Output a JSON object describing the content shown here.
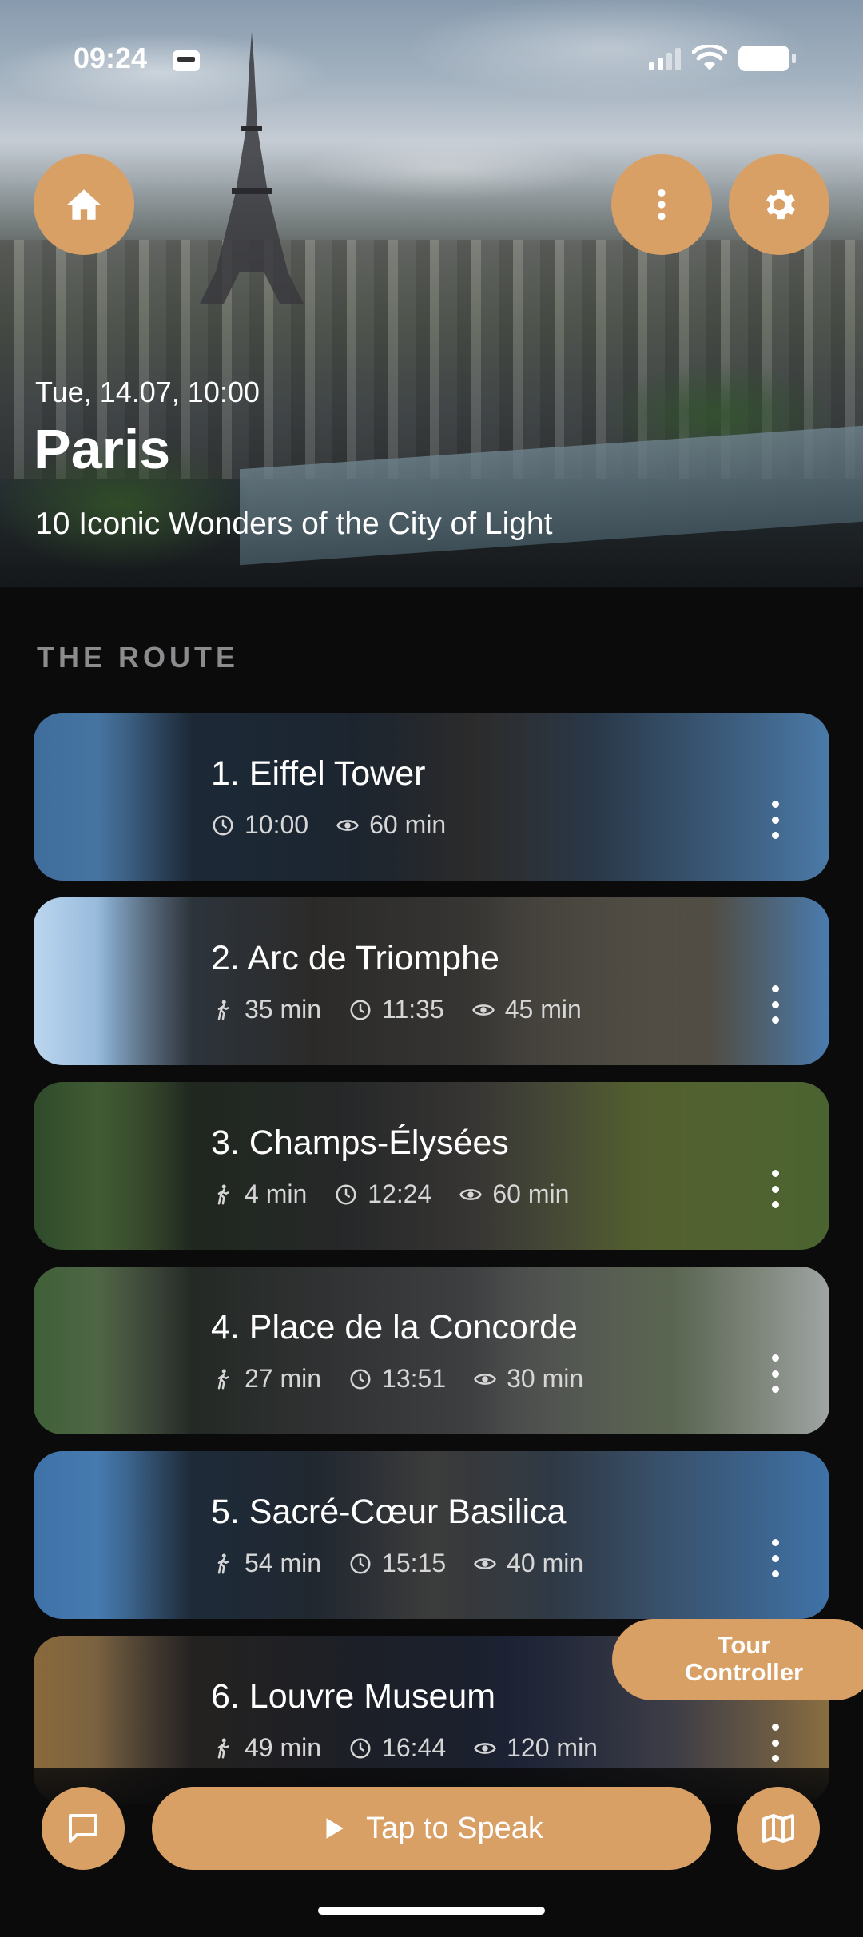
{
  "status_bar": {
    "time": "09:24"
  },
  "hero": {
    "date": "Tue, 14.07, 10:00",
    "city": "Paris",
    "subtitle": "10 Iconic Wonders of the City of Light"
  },
  "route": {
    "heading": "THE ROUTE",
    "stops": [
      {
        "title": "1. Eiffel Tower",
        "walk": "",
        "time": "10:00",
        "duration": "60 min"
      },
      {
        "title": "2. Arc de Triomphe",
        "walk": "35 min",
        "time": "11:35",
        "duration": "45 min"
      },
      {
        "title": "3. Champs-Élysées",
        "walk": "4 min",
        "time": "12:24",
        "duration": "60 min"
      },
      {
        "title": "4. Place de la Concorde",
        "walk": "27 min",
        "time": "13:51",
        "duration": "30 min"
      },
      {
        "title": "5. Sacré-Cœur Basilica",
        "walk": "54 min",
        "time": "15:15",
        "duration": "40 min"
      },
      {
        "title": "6. Louvre Museum",
        "walk": "49 min",
        "time": "16:44",
        "duration": "120 min"
      }
    ]
  },
  "tour_controller": {
    "line1": "Tour",
    "line2": "Controller"
  },
  "bottom": {
    "speak_label": "Tap to Speak"
  },
  "colors": {
    "accent": "#d9a066",
    "background": "#0b0b0c"
  },
  "icons": [
    "home-icon",
    "more-vert-icon",
    "gear-icon",
    "clock-icon",
    "eye-icon",
    "walk-icon",
    "chat-icon",
    "play-icon",
    "map-icon"
  ]
}
